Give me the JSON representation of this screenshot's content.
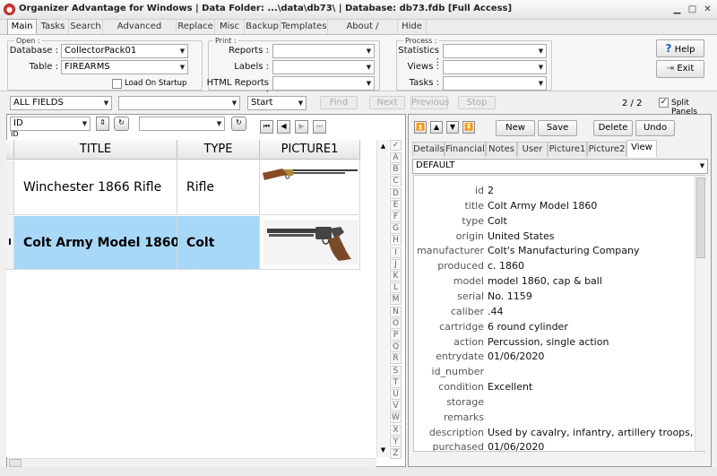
{
  "window": {
    "title": "Organizer Advantage for Windows | Data Folder: ...\\data\\db73\\ | Database: db73.fdb [Full Access]"
  },
  "tabs": [
    "Main",
    "Tasks",
    "Search",
    "Advanced Search",
    "Replace",
    "Misc",
    "Backup",
    "Templates",
    "About / Upgrade",
    "Hide"
  ],
  "open": {
    "title": "Open :",
    "database_label": "Database :",
    "database_value": "CollectorPack01",
    "table_label": "Table :",
    "table_value": "FIREARMS",
    "load_on_startup": "Load On Startup"
  },
  "print": {
    "title": "Print :",
    "reports": "Reports :",
    "labels": "Labels :",
    "html_reports": "HTML Reports :"
  },
  "process": {
    "title": "Process :",
    "statistics": "Statistics :",
    "views": "Views :",
    "tasks": "Tasks :"
  },
  "help_button": "Help",
  "exit_button": "Exit",
  "search": {
    "field": "ALL FIELDS",
    "mode": "Start",
    "find": "Find",
    "next": "Next",
    "previous": "Previous",
    "stop": "Stop",
    "count": "2 / 2",
    "split_panels": "Split Panels"
  },
  "sort": {
    "field": "ID",
    "sub": "ID"
  },
  "grid": {
    "columns": [
      "TITLE",
      "TYPE",
      "PICTURE1"
    ],
    "rows": [
      {
        "title": "Winchester 1866 Rifle",
        "type": "Rifle"
      },
      {
        "title": "Colt Army Model 1860",
        "type": "Colt"
      }
    ],
    "current_marker": "I"
  },
  "alphabet": [
    "A",
    "B",
    "C",
    "D",
    "E",
    "F",
    "G",
    "H",
    "I",
    "J",
    "K",
    "L",
    "M",
    "N",
    "O",
    "P",
    "Q",
    "R",
    "S",
    "T",
    "U",
    "V",
    "W",
    "X",
    "Y",
    "Z"
  ],
  "record_buttons": {
    "new": "New",
    "save": "Save",
    "delete": "Delete",
    "undo": "Undo"
  },
  "detail_tabs": [
    "Details",
    "Financial",
    "Notes",
    "User",
    "Picture1",
    "Picture2",
    "View"
  ],
  "view_select": "DEFAULT",
  "fields": [
    {
      "k": "id",
      "v": "2"
    },
    {
      "k": "title",
      "v": "Colt Army Model 1860"
    },
    {
      "k": "type",
      "v": "Colt"
    },
    {
      "k": "origin",
      "v": "United States"
    },
    {
      "k": "manufacturer",
      "v": "Colt's Manufacturing Company"
    },
    {
      "k": "produced",
      "v": "c. 1860"
    },
    {
      "k": "model",
      "v": "model 1860, cap & ball"
    },
    {
      "k": "serial",
      "v": "No. 1159"
    },
    {
      "k": "caliber",
      "v": ".44"
    },
    {
      "k": "cartridge",
      "v": "6 round cylinder"
    },
    {
      "k": "action",
      "v": "Percussion, single action"
    },
    {
      "k": "entrydate",
      "v": "01/06/2020"
    },
    {
      "k": "id_number",
      "v": ""
    },
    {
      "k": "condition",
      "v": "Excellent"
    },
    {
      "k": "storage",
      "v": ""
    },
    {
      "k": "remarks",
      "v": ""
    },
    {
      "k": "description",
      "v": "Used by cavalry, infantry, artillery troops, an"
    },
    {
      "k": "purchased",
      "v": "01/06/2020"
    }
  ]
}
